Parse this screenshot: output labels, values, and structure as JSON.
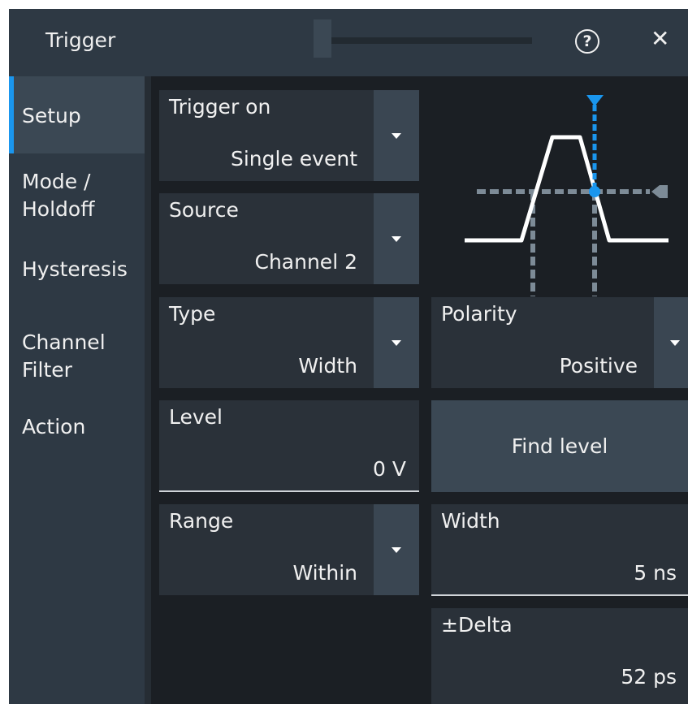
{
  "window": {
    "title": "Trigger",
    "help_icon": "?",
    "close_icon": "✕"
  },
  "sidebar": {
    "items": [
      {
        "label": "Setup"
      },
      {
        "label": "Mode /\nHoldoff"
      },
      {
        "label": "Hysteresis"
      },
      {
        "label": "Channel\nFilter"
      },
      {
        "label": "Action"
      }
    ],
    "active": "Setup"
  },
  "fields": {
    "trigger_on": {
      "label": "Trigger on",
      "value": "Single event"
    },
    "source": {
      "label": "Source",
      "value": "Channel 2"
    },
    "type": {
      "label": "Type",
      "value": "Width"
    },
    "polarity": {
      "label": "Polarity",
      "value": "Positive"
    },
    "level": {
      "label": "Level",
      "value": "0 V"
    },
    "find_level": {
      "label": "Find level"
    },
    "range": {
      "label": "Range",
      "value": "Within"
    },
    "width": {
      "label": "Width",
      "value": "5 ns"
    },
    "delta": {
      "label": "±Delta",
      "value": "52 ps"
    }
  },
  "colors": {
    "accent": "#1a96ee",
    "background": "#1b1f24",
    "panel": "#2a3139",
    "sidebar": "#2e3944"
  },
  "icons": [
    "help-icon",
    "close-icon",
    "dropdown-caret-icon",
    "positive-pulse-width-diagram"
  ]
}
